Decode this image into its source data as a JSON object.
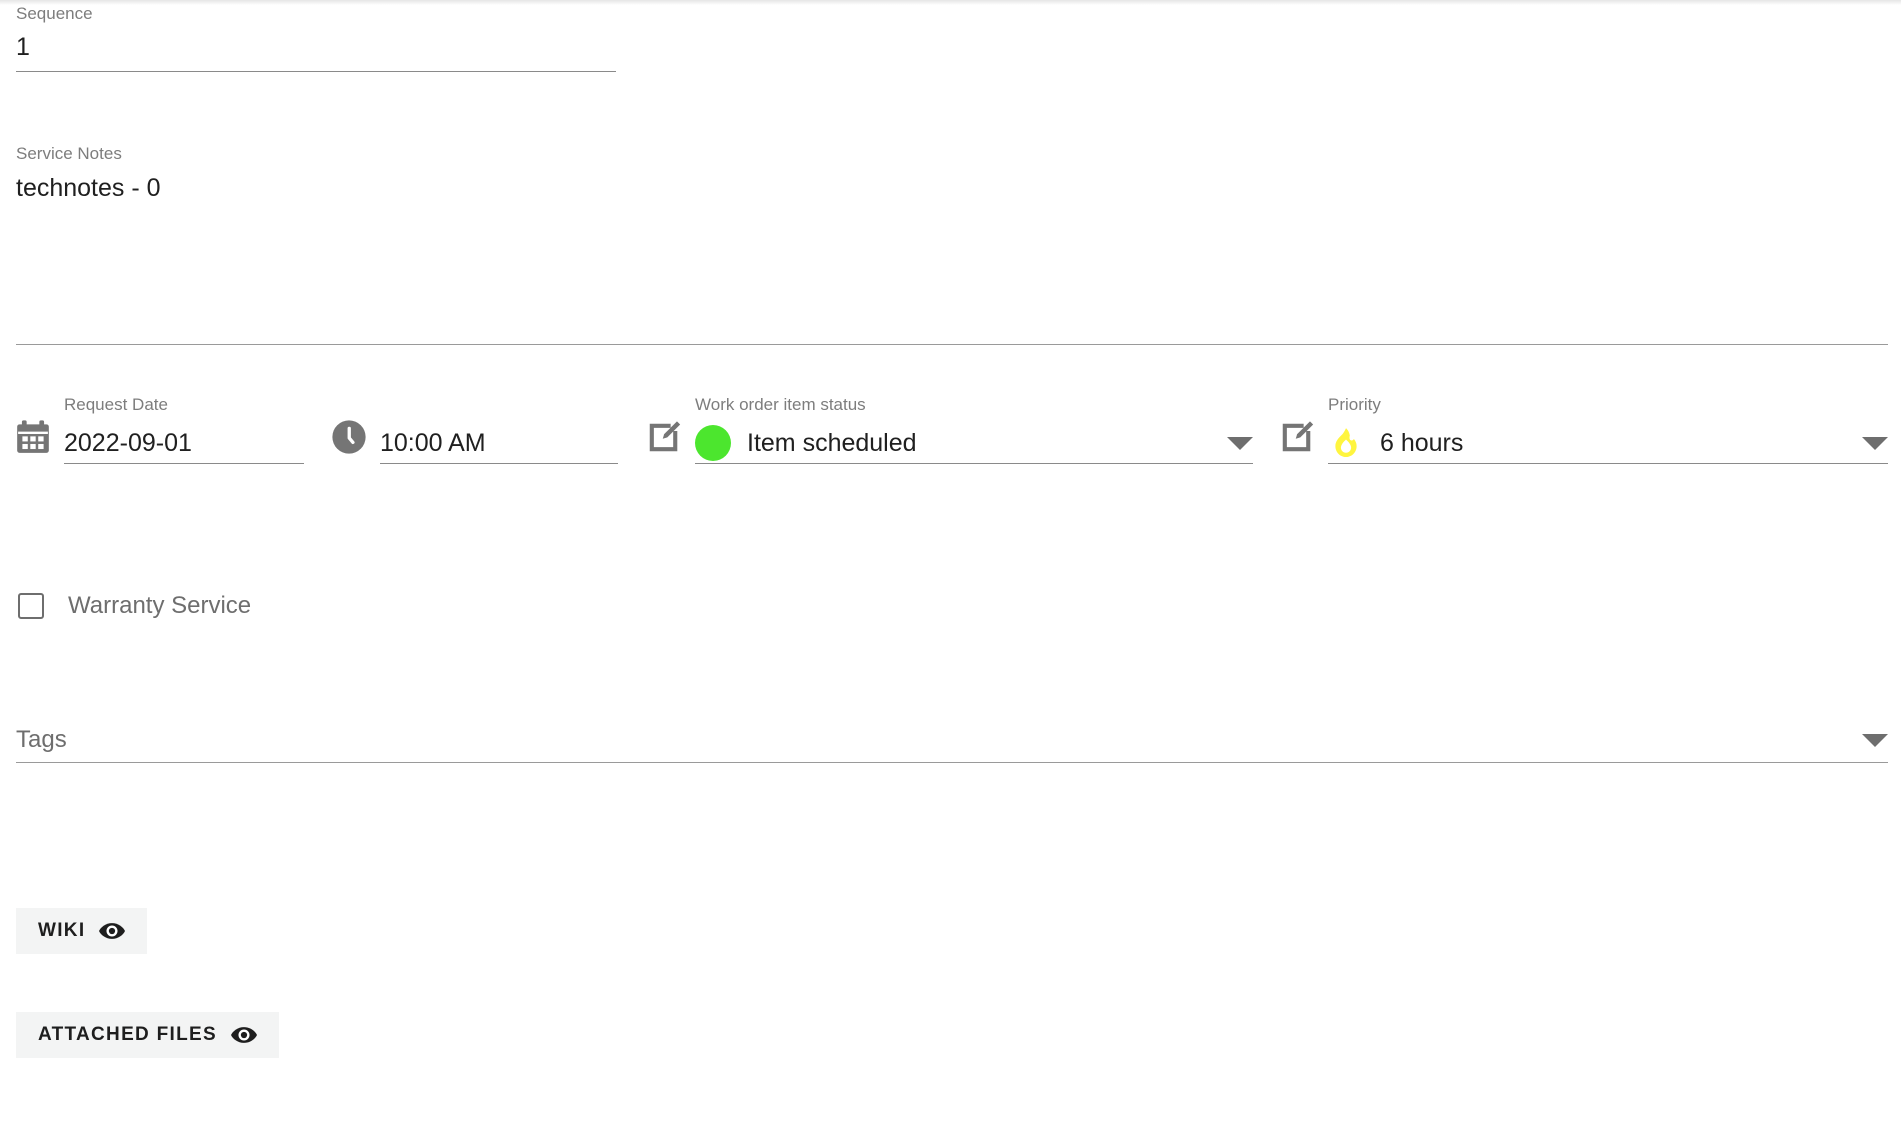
{
  "form": {
    "sequence": {
      "label": "Sequence",
      "value": "1"
    },
    "service_notes": {
      "label": "Service Notes",
      "value": "technotes - 0"
    },
    "request_date": {
      "label": "Request Date",
      "value": "2022-09-01",
      "icon": "calendar-icon"
    },
    "request_time": {
      "value": "10:00 AM",
      "icon": "clock-icon"
    },
    "work_order_item_status": {
      "label": "Work order item status",
      "value": "Item scheduled",
      "status_color": "#4ce62e",
      "edit_icon": "edit-icon",
      "caret_icon": "chevron-down-icon"
    },
    "priority": {
      "label": "Priority",
      "value": "6 hours",
      "flame_color": "#fff53f",
      "edit_icon": "edit-icon",
      "caret_icon": "chevron-down-icon"
    },
    "warranty_service": {
      "label": "Warranty Service",
      "checked": false
    },
    "tags": {
      "placeholder": "Tags",
      "value": "",
      "caret_icon": "chevron-down-icon"
    }
  },
  "buttons": {
    "wiki": {
      "label": "WIKI",
      "icon": "eye-icon"
    },
    "attached_files": {
      "label": "ATTACHED FILES",
      "icon": "eye-icon"
    }
  },
  "colors": {
    "divider": "#9a9a9a",
    "label_text": "#7d7d7d",
    "value_text": "#202020",
    "chip_background": "#f3f4f4"
  }
}
